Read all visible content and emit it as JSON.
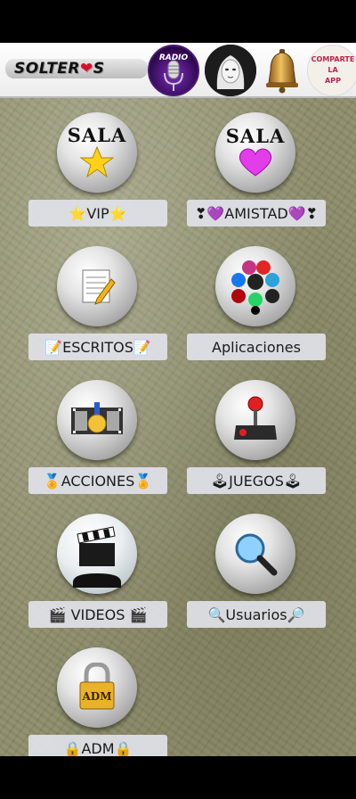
{
  "header": {
    "logo_text_1": "SOLTER",
    "logo_heart": "❤",
    "logo_text_2": "S",
    "radio_label": "RADIO",
    "share": {
      "line1": "COMPARTE",
      "line2": "LA",
      "line3": "APP"
    }
  },
  "orbs": {
    "sala_text": "SALA",
    "adm_text": "ADM"
  },
  "menu": [
    {
      "label": "⭐VIP⭐",
      "icon": "star-icon"
    },
    {
      "label": "❣💜AMISTAD💜❣",
      "icon": "purple-heart-icon"
    },
    {
      "label": "📝ESCRITOS📝",
      "icon": "notepad-icon"
    },
    {
      "label": "Aplicaciones",
      "icon": "social-apps-icon"
    },
    {
      "label": "🏅ACCIONES🏅",
      "icon": "film-medal-icon"
    },
    {
      "label": "🕹JUEGOS🕹",
      "icon": "joystick-icon"
    },
    {
      "label": "🎬 VIDEOS 🎬",
      "icon": "clapperboard-globe-icon"
    },
    {
      "label": "🔍Usuarios🔎",
      "icon": "magnifier-icon"
    },
    {
      "label": "🔒ADM🔒",
      "icon": "padlock-icon"
    }
  ],
  "colors": {
    "background": "#8e8d6b",
    "label_bg": "#e1e2e9",
    "accent_purple": "#7b2dbe",
    "heart_red": "#d6112a"
  }
}
